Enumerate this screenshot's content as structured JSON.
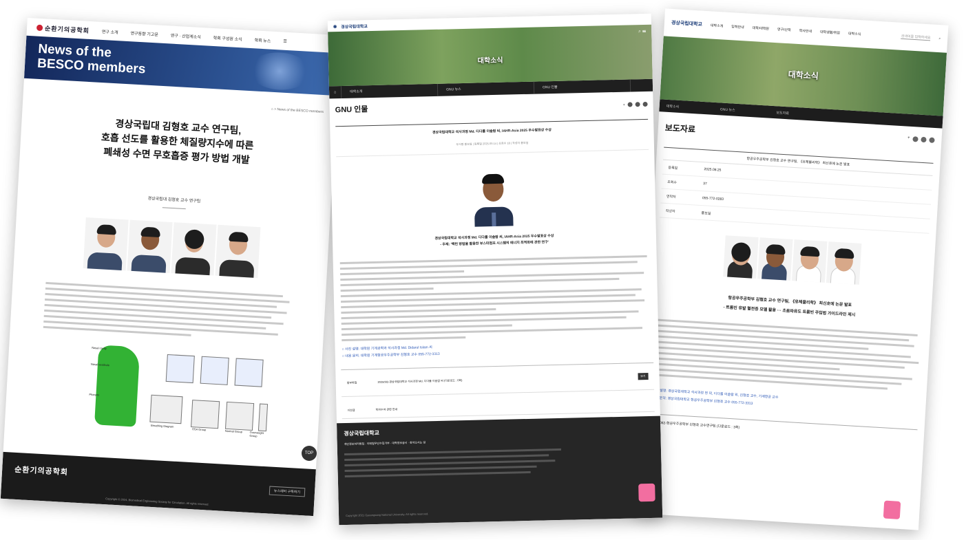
{
  "left": {
    "logo": "순환기의공학회",
    "nav": [
      "연구 소개",
      "연구동향 기고문",
      "연구 · 산업계소식",
      "학회 구성원 소식",
      "학회 뉴스"
    ],
    "banner_line1": "News of the",
    "banner_line2": "BESCO members",
    "breadcrumb": "> News of the BESCO members",
    "title_line1": "경상국립대 김형호 교수 연구팀,",
    "title_line2": "호흡 선도를 활용한 체질량지수에 따른",
    "title_line3": "폐쇄성 수면 무호흡증 평가 방법 개발",
    "subtitle": "경상국립대 김형호 교수 연구팀",
    "fig_labels": [
      "Nasal cavity",
      "Nasal vestibule",
      "Pharynx",
      "Breathing Diagram",
      "OSA Group",
      "Normal Group",
      "Overweight Group"
    ],
    "footer_logo": "순환기의공학회",
    "newsletter_button": "뉴스레터 구독하기",
    "copyright": "Copyright © 2024, Biomedical Engineering Society for Circulation. All rights reserved.",
    "top_label": "TOP"
  },
  "middle": {
    "site_logo": "경상국립대학교",
    "hero_title": "대학소식",
    "nav_bar": [
      "대학소개",
      "GNU 뉴스",
      "GNU 인물"
    ],
    "page_title": "GNU 인물",
    "article_head": "경상국립대학교 석사과정 Md. 디다룰 이슬람 씨, IAHR-Asia 2025 우수발표상 수상",
    "meta": "부서명 홍보실 | 등록일 2025.09.14 | 조회수 18 | 작성자 홍보실",
    "highlight_line1": "경상국립대학교 석사과정 Md. 디다룰 이슬람 씨, IAHR-Asia 2025 우수발표상 수상",
    "highlight_line2": "- 주제: '백턴 방법을 활용한 부스터펌프 시스템의 에너지 최적화에 관한 연구'",
    "link1": "○ 사진 설명: 대학원 기계공학과 석사과정 Md. Didarul Islam 씨",
    "link2": "○ 내용 문의: 대학원 기계항공우주공학부 김형호 교수 055-772-3313",
    "attachment_label": "첨부파일",
    "attachment_name": "2025092-경상국립대학교 석사과정 Md. 디다룰 이슬람 씨 (다운로드 : 0회)",
    "download_button": "보기",
    "prev_label": "이전글",
    "prev_title": "학위수여 관련 안내",
    "contact": "담당부서 : 대외협력과   연락처 : 055-772-0277",
    "footer_logo": "경상국립대학교",
    "footer_links": "개인정보처리방침 · 이메일무단수집거부 · 대학정보공시 · 찾아오시는 길",
    "footer_copy": "Copyright 2021 Gyeongsang National University. All rights reserved."
  },
  "right": {
    "site_logo": "경상국립대학교",
    "nav": [
      "대학소개",
      "입학안내",
      "대학/대학원",
      "연구/산학",
      "학사안내",
      "대학생활/취업",
      "대학소식"
    ],
    "search_placeholder": "검색어를 입력하세요",
    "hero_title": "대학소식",
    "bar": [
      "대학소식",
      "GNU 뉴스",
      "보도자료"
    ],
    "page_title": "보도자료",
    "article_head": "항공우주공학부 김형호 교수 연구팀, 《유체물리학》 최신호에 논문 발표",
    "rows": [
      {
        "k": "등록일",
        "v": "2025.08.25"
      },
      {
        "k": "조회수",
        "v": "37"
      },
      {
        "k": "연락처",
        "v": "055-772-0283"
      },
      {
        "k": "작성자",
        "v": "홍보실"
      }
    ],
    "highlight_line1": "항공우주공학부 김형호 교수 연구팀, 《유체물리학》 최신호에 논문 발표",
    "highlight_line2": "- 트롬빈 유발 혈전증 모델 활용 ··· 초음파유도 트롬빈 주입법 가이드라인 제시",
    "link1": "○ 사진 설명: 경상국립대학교 석사과정 정 외, 디다룰 이슬람 외, 김형호 교수, 기계항공 교수",
    "link2": "○ 내용 문의: 경상국립대학교 항공우주공학부 김형호 교수 055-772-3313",
    "attachment_name": "2025082-항공우주공학부 김형호 교수연구팀 (다운로드 : 3회)"
  }
}
